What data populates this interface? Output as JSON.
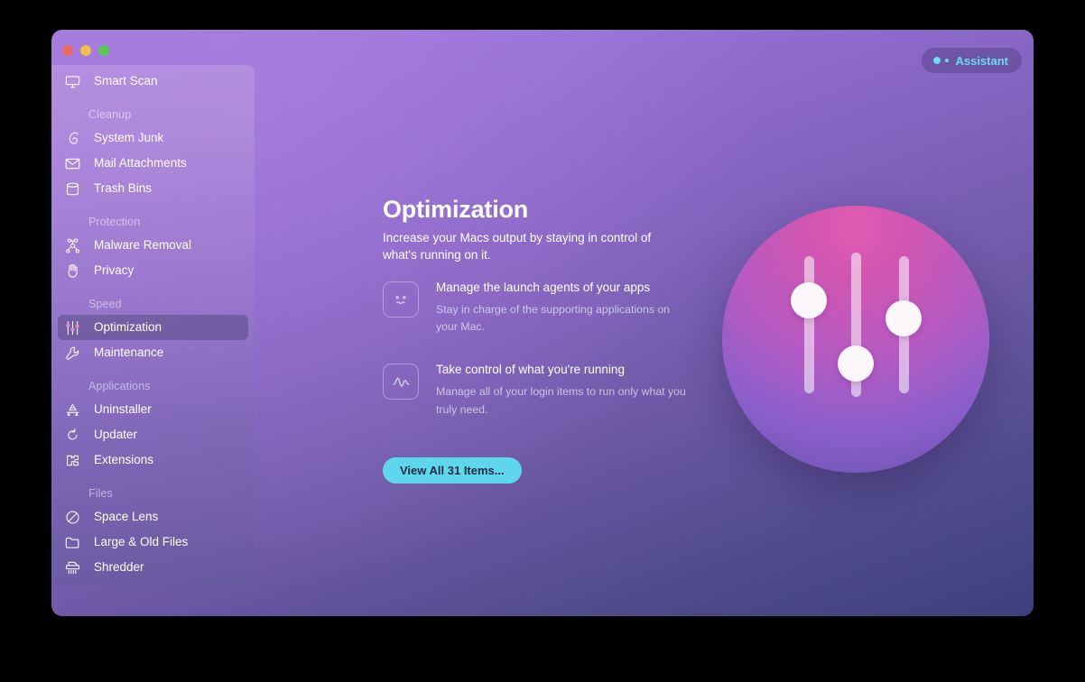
{
  "window": {
    "traffic_lights": [
      "close",
      "minimize",
      "zoom"
    ],
    "assistant_label": "Assistant"
  },
  "sidebar": {
    "top_item": {
      "label": "Smart Scan",
      "icon": "display-icon"
    },
    "groups": [
      {
        "label": "Cleanup",
        "items": [
          {
            "label": "System Junk",
            "icon": "broom-icon",
            "selected": false
          },
          {
            "label": "Mail Attachments",
            "icon": "envelope-icon",
            "selected": false
          },
          {
            "label": "Trash Bins",
            "icon": "trash-bin-icon",
            "selected": false
          }
        ]
      },
      {
        "label": "Protection",
        "items": [
          {
            "label": "Malware Removal",
            "icon": "biohazard-icon",
            "selected": false
          },
          {
            "label": "Privacy",
            "icon": "hand-icon",
            "selected": false
          }
        ]
      },
      {
        "label": "Speed",
        "items": [
          {
            "label": "Optimization",
            "icon": "sliders-icon",
            "selected": true
          },
          {
            "label": "Maintenance",
            "icon": "wrench-icon",
            "selected": false
          }
        ]
      },
      {
        "label": "Applications",
        "items": [
          {
            "label": "Uninstaller",
            "icon": "uninstaller-icon",
            "selected": false
          },
          {
            "label": "Updater",
            "icon": "refresh-arrow-icon",
            "selected": false
          },
          {
            "label": "Extensions",
            "icon": "puzzle-piece-icon",
            "selected": false
          }
        ]
      },
      {
        "label": "Files",
        "items": [
          {
            "label": "Space Lens",
            "icon": "space-lens-icon",
            "selected": false
          },
          {
            "label": "Large & Old Files",
            "icon": "folder-icon",
            "selected": false
          },
          {
            "label": "Shredder",
            "icon": "shredder-icon",
            "selected": false
          }
        ]
      }
    ]
  },
  "main": {
    "title": "Optimization",
    "subtitle": "Increase your Macs output by staying in control of what's running on it.",
    "features": [
      {
        "icon": "x-eyes-face-icon",
        "title": "Manage the launch agents of your apps",
        "description": "Stay in charge of the supporting applications on your Mac."
      },
      {
        "icon": "pulse-waveform-icon",
        "title": "Take control of what you're running",
        "description": "Manage all of your login items to run only what you truly need."
      }
    ],
    "primary_button": "View All 31 Items...",
    "illustration": {
      "name": "sliders-circle-illustration",
      "gradient_top": "#d356b0",
      "gradient_bottom": "#7457b8",
      "sliders": [
        {
          "knob_position_pct": 26
        },
        {
          "knob_position_pct": 68
        },
        {
          "knob_position_pct": 40
        }
      ]
    }
  },
  "colors": {
    "accent_cyan": "#5ed7ec",
    "bg_top": "#9f78de",
    "bg_bottom": "#3f3f7d"
  }
}
